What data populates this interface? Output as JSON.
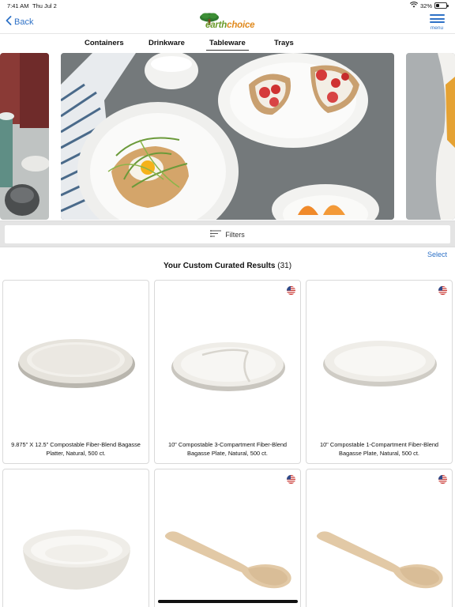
{
  "status_bar": {
    "time": "7:41 AM",
    "date": "Thu Jul 2",
    "battery": "32%"
  },
  "nav": {
    "back_label": "Back",
    "logo_text": "earthchoice",
    "menu_label": "menu"
  },
  "tabs": [
    {
      "label": "Containers",
      "active": false
    },
    {
      "label": "Drinkware",
      "active": false
    },
    {
      "label": "Tableware",
      "active": true
    },
    {
      "label": "Trays",
      "active": false
    }
  ],
  "filters": {
    "label": "Filters"
  },
  "results": {
    "select_label": "Select",
    "title": "Your Custom Curated Results",
    "count": "(31)"
  },
  "products": [
    {
      "name": "9.875\" X 12.5\" Compostable Fiber-Blend Bagasse Platter, Natural, 500 ct.",
      "usa_flag": false,
      "thumb": "oval-platter"
    },
    {
      "name": "10\" Compostable 3-Compartment Fiber-Blend Bagasse Plate, Natural, 500 ct.",
      "usa_flag": true,
      "thumb": "compartment-plate"
    },
    {
      "name": "10\" Compostable 1-Compartment Fiber-Blend Bagasse Plate, Natural, 500 ct.",
      "usa_flag": true,
      "thumb": "round-plate"
    },
    {
      "name": "",
      "usa_flag": false,
      "thumb": "bowl"
    },
    {
      "name": "",
      "usa_flag": true,
      "thumb": "spoon"
    },
    {
      "name": "",
      "usa_flag": true,
      "thumb": "spoon"
    }
  ]
}
